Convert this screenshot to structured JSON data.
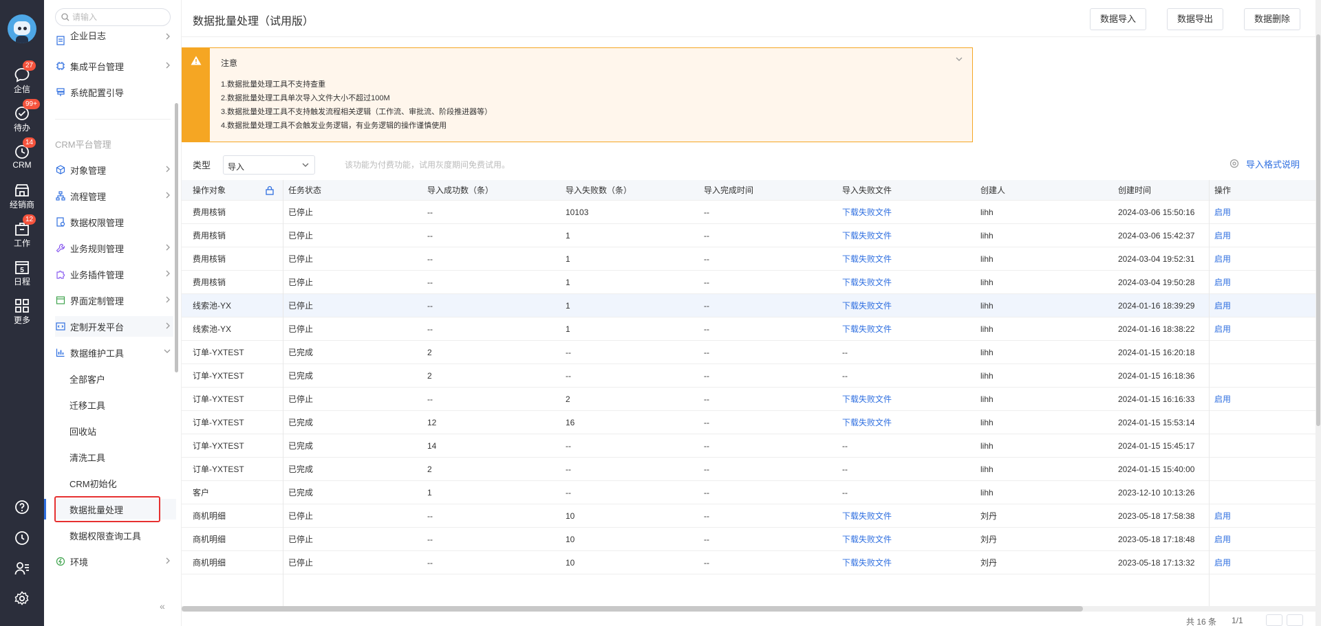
{
  "rail": {
    "items": [
      {
        "label": "企信",
        "badge": "27"
      },
      {
        "label": "待办",
        "badge": "99+"
      },
      {
        "label": "CRM",
        "badge": "14"
      },
      {
        "label": "经销商",
        "badge": ""
      },
      {
        "label": "工作",
        "badge": "12"
      },
      {
        "label": "日程",
        "badge": "",
        "day": "5"
      },
      {
        "label": "更多",
        "badge": ""
      }
    ]
  },
  "sidebar": {
    "search_placeholder": "请输入",
    "top_items": [
      "企业日志",
      "集成平台管理",
      "系统配置引导"
    ],
    "section": "CRM平台管理",
    "items": [
      "对象管理",
      "流程管理",
      "数据权限管理",
      "业务规则管理",
      "业务插件管理",
      "界面定制管理",
      "定制开发平台",
      "数据维护工具"
    ],
    "sub_items": [
      "全部客户",
      "迁移工具",
      "回收站",
      "清洗工具",
      "CRM初始化",
      "数据批量处理",
      "数据权限查询工具"
    ],
    "last_item": "环境",
    "collapse": "«"
  },
  "header": {
    "title": "数据批量处理（试用版）",
    "buttons": [
      "数据导入",
      "数据导出",
      "数据删除"
    ]
  },
  "notice": {
    "title": "注意",
    "lines": [
      "1.数据批量处理工具不支持查重",
      "2.数据批量处理工具单次导入文件大小不超过100M",
      "3.数据批量处理工具不支持触发流程相关逻辑（工作流、审批流、阶段推进器等）",
      "4.数据批量处理工具不会触发业务逻辑，有业务逻辑的操作谨慎使用"
    ]
  },
  "filter": {
    "label": "类型",
    "value": "导入",
    "hint": "该功能为付费功能，试用灰度期间免费试用。",
    "format_link": "导入格式说明"
  },
  "table": {
    "columns": [
      "操作对象",
      "任务状态",
      "导入成功数（条）",
      "导入失败数（条）",
      "导入完成时间",
      "导入失败文件",
      "创建人",
      "创建时间",
      "操作"
    ],
    "rows": [
      [
        "费用核销",
        "已停止",
        "--",
        "10103",
        "--",
        "下载失败文件",
        "lihh",
        "2024-03-06 15:50:16",
        "启用"
      ],
      [
        "费用核销",
        "已停止",
        "--",
        "1",
        "--",
        "下载失败文件",
        "lihh",
        "2024-03-06 15:42:37",
        "启用"
      ],
      [
        "费用核销",
        "已停止",
        "--",
        "1",
        "--",
        "下载失败文件",
        "lihh",
        "2024-03-04 19:52:31",
        "启用"
      ],
      [
        "费用核销",
        "已停止",
        "--",
        "1",
        "--",
        "下载失败文件",
        "lihh",
        "2024-03-04 19:50:28",
        "启用"
      ],
      [
        "线索池-YX",
        "已停止",
        "--",
        "1",
        "--",
        "下载失败文件",
        "lihh",
        "2024-01-16 18:39:29",
        "启用"
      ],
      [
        "线索池-YX",
        "已停止",
        "--",
        "1",
        "--",
        "下载失败文件",
        "lihh",
        "2024-01-16 18:38:22",
        "启用"
      ],
      [
        "订单-YXTEST",
        "已完成",
        "2",
        "--",
        "--",
        "--",
        "lihh",
        "2024-01-15 16:20:18",
        ""
      ],
      [
        "订单-YXTEST",
        "已完成",
        "2",
        "--",
        "--",
        "--",
        "lihh",
        "2024-01-15 16:18:36",
        ""
      ],
      [
        "订单-YXTEST",
        "已停止",
        "--",
        "2",
        "--",
        "下载失败文件",
        "lihh",
        "2024-01-15 16:16:33",
        "启用"
      ],
      [
        "订单-YXTEST",
        "已完成",
        "12",
        "16",
        "--",
        "下载失败文件",
        "lihh",
        "2024-01-15 15:53:14",
        ""
      ],
      [
        "订单-YXTEST",
        "已完成",
        "14",
        "--",
        "--",
        "--",
        "lihh",
        "2024-01-15 15:45:17",
        ""
      ],
      [
        "订单-YXTEST",
        "已完成",
        "2",
        "--",
        "--",
        "--",
        "lihh",
        "2024-01-15 15:40:00",
        ""
      ],
      [
        "客户",
        "已完成",
        "1",
        "--",
        "--",
        "--",
        "lihh",
        "2023-12-10 10:13:26",
        ""
      ],
      [
        "商机明细",
        "已停止",
        "--",
        "10",
        "--",
        "下载失败文件",
        "刘丹",
        "2023-05-18 17:58:38",
        "启用"
      ],
      [
        "商机明细",
        "已停止",
        "--",
        "10",
        "--",
        "下载失败文件",
        "刘丹",
        "2023-05-18 17:18:48",
        "启用"
      ],
      [
        "商机明细",
        "已停止",
        "--",
        "10",
        "--",
        "下载失败文件",
        "刘丹",
        "2023-05-18 17:13:32",
        "启用"
      ]
    ]
  },
  "pager": {
    "total": "共 16 条",
    "page": "1/1"
  },
  "colors": {
    "accent": "#2f6fe0",
    "warning": "#f5a623",
    "highlight_border": "#e63030",
    "rail_bg": "#2b2e3b"
  }
}
